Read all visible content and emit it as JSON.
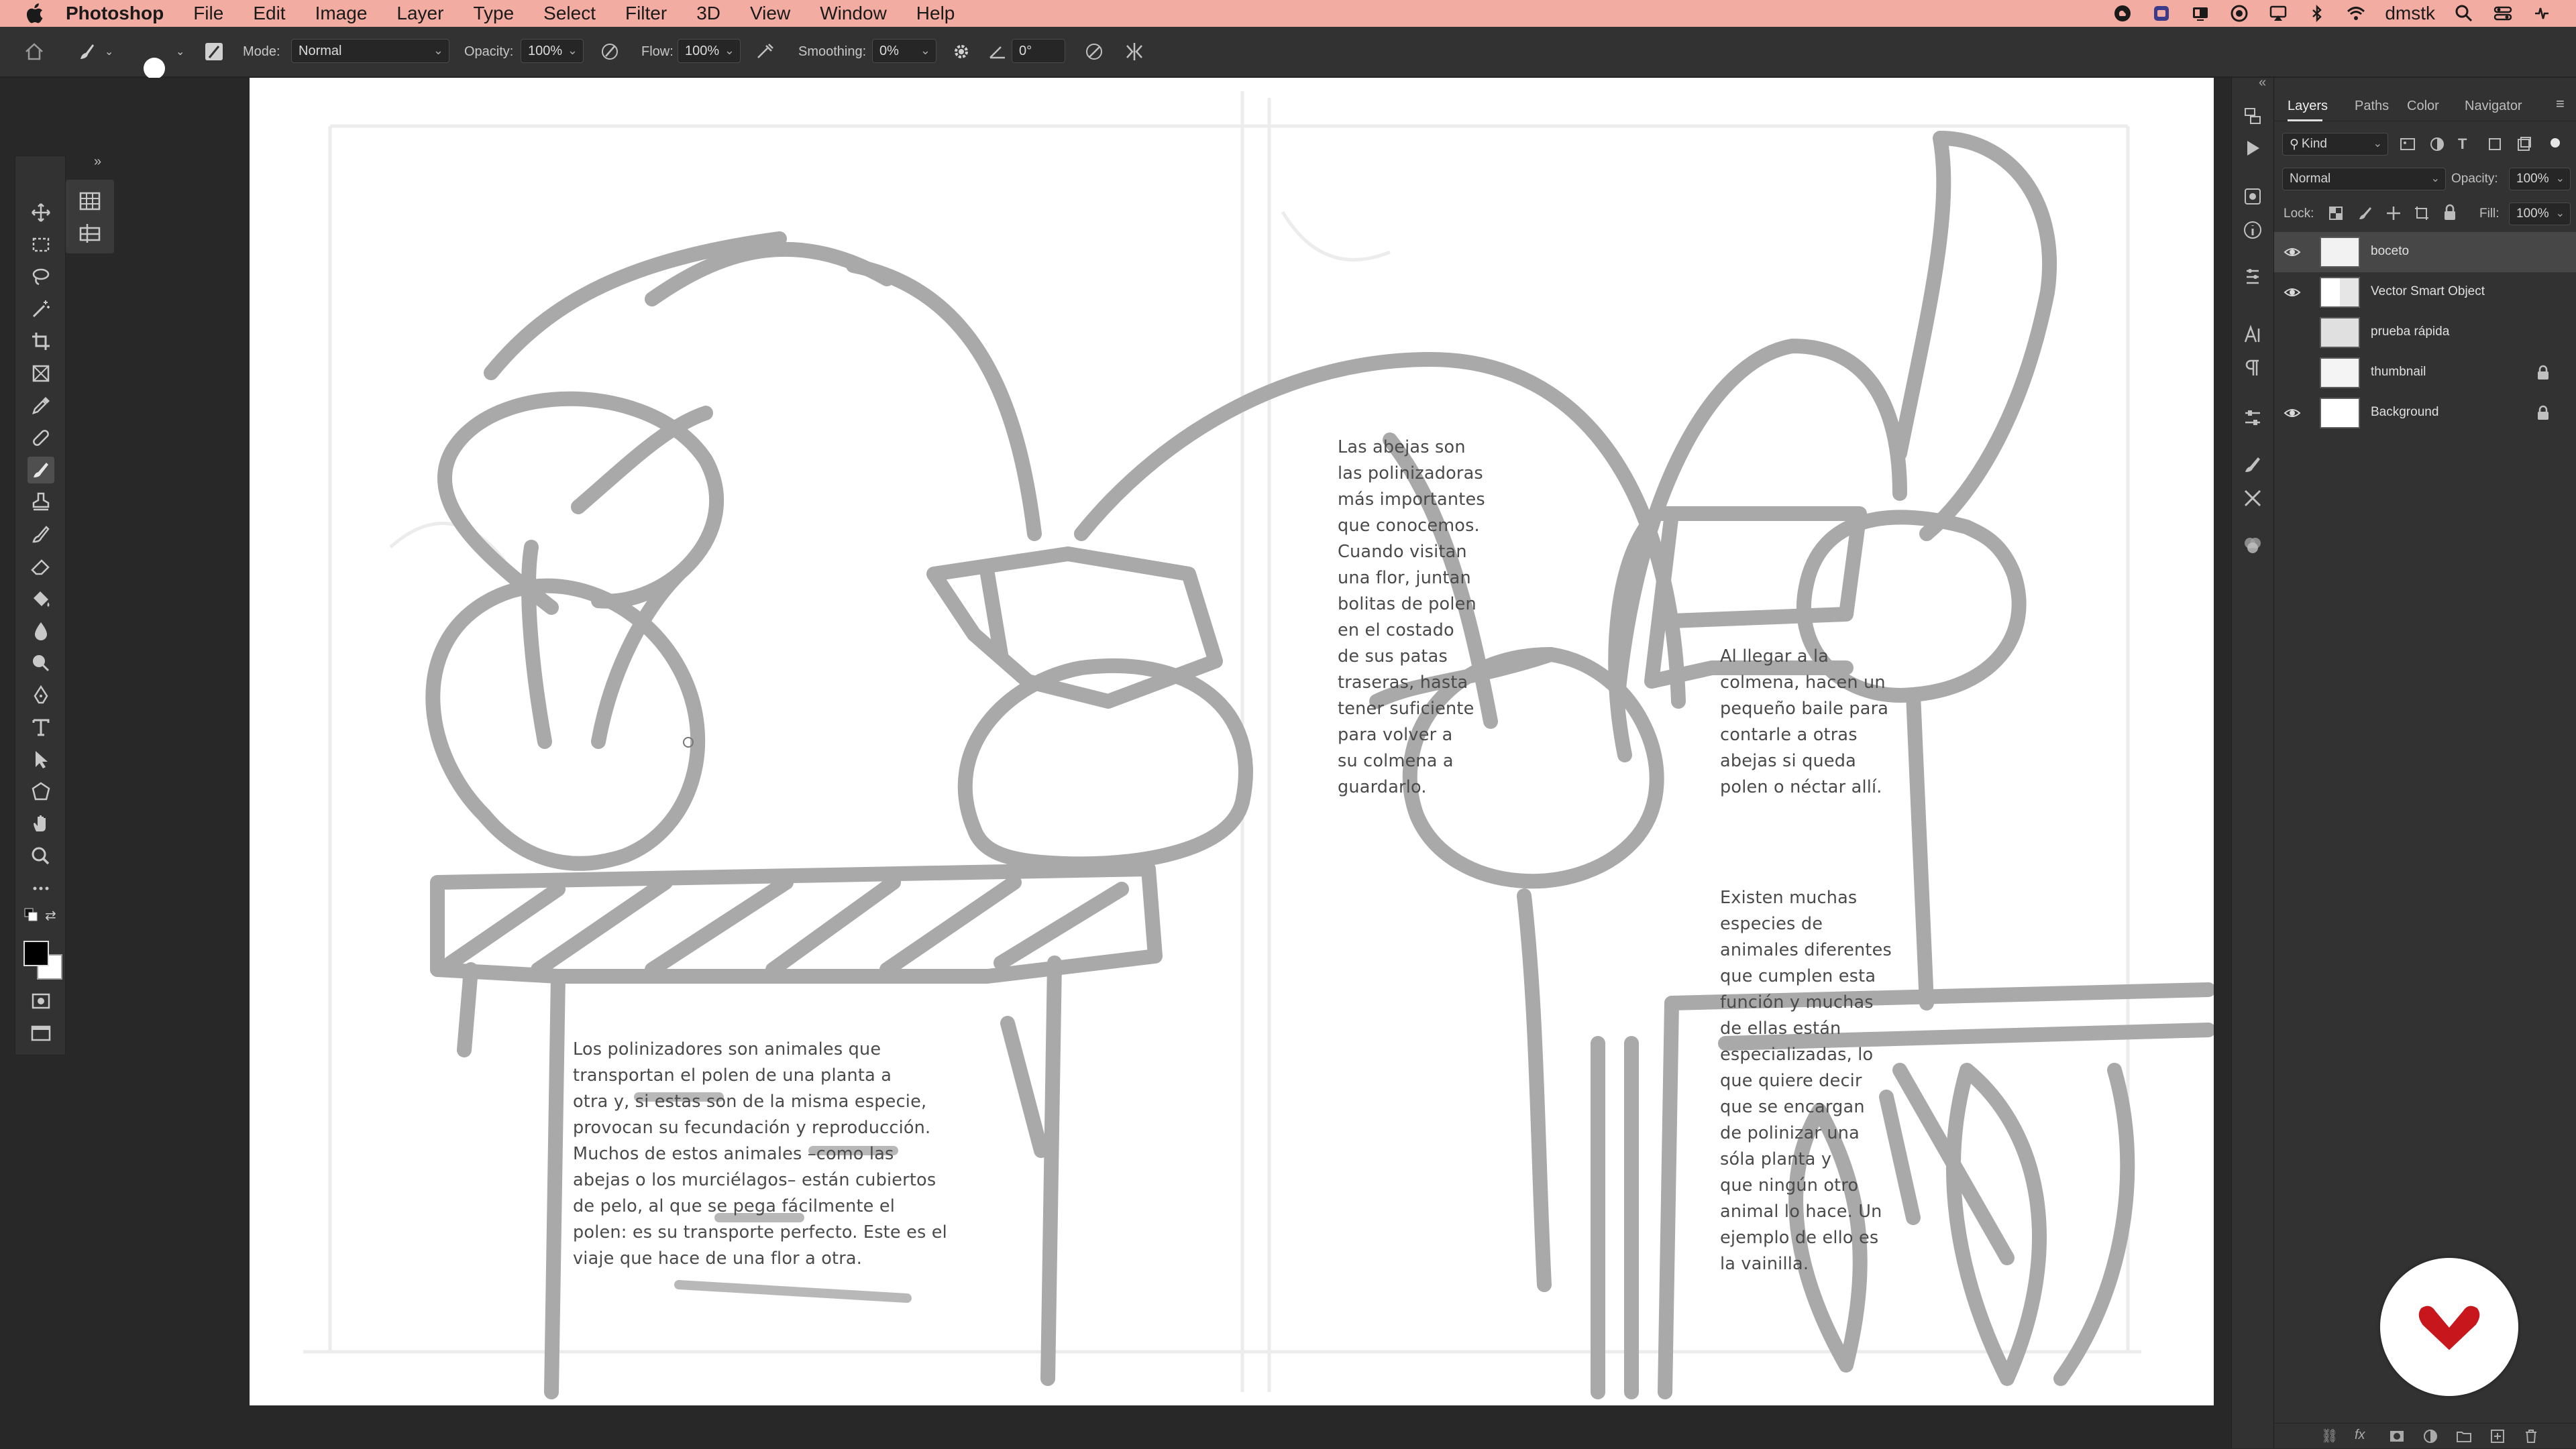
{
  "menubar": {
    "app_name": "Photoshop",
    "menus": [
      "File",
      "Edit",
      "Image",
      "Layer",
      "Type",
      "Select",
      "Filter",
      "3D",
      "View",
      "Window",
      "Help"
    ],
    "user": "dmstk",
    "status_icons": [
      "creative-cloud-icon",
      "wacom-icon",
      "display-icon",
      "screen-record-icon",
      "airplay-icon",
      "bluetooth-icon",
      "wifi-icon",
      "search-icon",
      "control-center-icon",
      "siri-icon"
    ]
  },
  "options_bar": {
    "brush_size": "30",
    "mode_label": "Mode:",
    "mode_value": "Normal",
    "opacity_label": "Opacity:",
    "opacity_value": "100%",
    "flow_label": "Flow:",
    "flow_value": "100%",
    "smoothing_label": "Smoothing:",
    "smoothing_value": "0%",
    "angle_value": "0°"
  },
  "tools": [
    "move-tool",
    "marquee-tool",
    "lasso-tool",
    "magic-wand-tool",
    "crop-tool",
    "frame-tool",
    "eyedropper-tool",
    "healing-tool",
    "brush-tool",
    "stamp-tool",
    "history-brush-tool",
    "eraser-tool",
    "paint-bucket-tool",
    "blur-tool",
    "dodge-tool",
    "pen-tool",
    "type-tool",
    "path-selection-tool",
    "shape-tool",
    "hand-tool",
    "zoom-tool",
    "more-tools"
  ],
  "active_tool": "brush-tool",
  "document": {
    "text_blocks": [
      {
        "id": "polinizadores",
        "text": "Los polinizadores son animales que\ntransportan el polen de una planta a\notra y, si estas son de la misma especie,\nprovocan su fecundación y reproducción.\nMuchos de estos animales –como las\nabejas o los murciélagos– están cubiertos\nde pelo, al que se pega fácilmente el\npolen: es su transporte perfecto. Este es el\nviaje que hace de una flor a otra."
      },
      {
        "id": "abejas",
        "text": "Las abejas son\nlas polinizadoras\nmás importantes\nque conocemos.\nCuando visitan\nuna flor, juntan\nbolitas de polen\nen el costado\nde sus patas\ntraseras, hasta\ntener suficiente\npara volver a\nsu colmena a\nguardarlo."
      },
      {
        "id": "colmena",
        "text": "Al llegar a la\ncolmena, hacen un\npequeño baile para\ncontarle a otras\nabejas si queda\npolen o néctar allí."
      },
      {
        "id": "especies",
        "text": "Existen muchas\nespecies de\nanimales diferentes\nque cumplen esta\nfunción y muchas\nde ellas están\nespecializadas, lo\nque quiere decir\nque se encargan\nde polinizar una\nsóla planta y\nque ningún otro\nanimal lo hace. Un\nejemplo de ello es\nla vainilla."
      }
    ]
  },
  "panel": {
    "tabs": [
      "Layers",
      "Paths",
      "Color",
      "Navigator"
    ],
    "active_tab": "Layers",
    "kind_filter": "Kind",
    "blend_mode": "Normal",
    "opacity_label": "Opacity:",
    "opacity_value": "100%",
    "lock_label": "Lock:",
    "fill_label": "Fill:",
    "fill_value": "100%",
    "layers": [
      {
        "name": "boceto",
        "visible": true,
        "selected": true,
        "locked": false
      },
      {
        "name": "Vector Smart Object",
        "visible": true,
        "selected": false,
        "locked": false
      },
      {
        "name": "prueba rápida",
        "visible": false,
        "selected": false,
        "locked": false
      },
      {
        "name": "thumbnail",
        "visible": false,
        "selected": false,
        "locked": true
      },
      {
        "name": "Background",
        "visible": true,
        "selected": false,
        "locked": true
      }
    ]
  },
  "colors": {
    "menubar_bg": "#f3aca2",
    "sketch_stroke": "#a9a9a9",
    "logo_red": "#c8161d"
  }
}
